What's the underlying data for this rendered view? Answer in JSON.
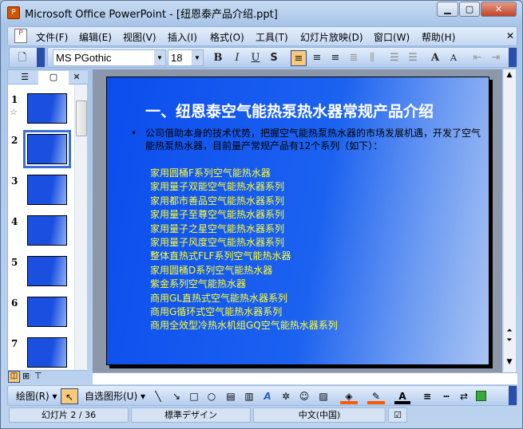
{
  "window": {
    "title": "Microsoft Office PowerPoint - [纽恩泰产品介绍.ppt]"
  },
  "menu": [
    "文件(F)",
    "编辑(E)",
    "视图(V)",
    "插入(I)",
    "格式(O)",
    "工具(T)",
    "幻灯片放映(D)",
    "窗口(W)",
    "帮助(H)"
  ],
  "format": {
    "font": "MS PGothic",
    "size": "18"
  },
  "thumbnails": [
    "1",
    "2",
    "3",
    "4",
    "5",
    "6",
    "7"
  ],
  "slide": {
    "title": "一、纽恩泰空气能热泵热水器常规产品介绍",
    "bullet": "公司借助本身的技术优势，把握空气能热泵热水器的市场发展机遇，开发了空气能热泵热水器，目前量产常规产品有12个系列（如下）：",
    "series": [
      "家用圆桶F系列空气能热水器",
      "家用量子双能空气能热水器系列",
      "家用都市善品空气能热水器系列",
      "家用量子至尊空气能热水器系列",
      "家用量子之星空气能热水器系列",
      "家用量子风度空气能热水器系列",
      "整体直热式FLF系列空气能热水器",
      "家用圆桶D系列空气能热水器",
      "紫金系列空气能热水器",
      "商用GL直热式空气能热水器系列",
      "商用G循环式空气能热水器系列",
      "商用全效型冷热水机组GQ空气能热水器系列"
    ]
  },
  "drawing": {
    "draw": "绘图(R)",
    "autoshapes": "自选图形(U)"
  },
  "status": {
    "slide": "幻灯片 2 / 36",
    "design": "標準デザイン",
    "language": "中文(中国)"
  }
}
